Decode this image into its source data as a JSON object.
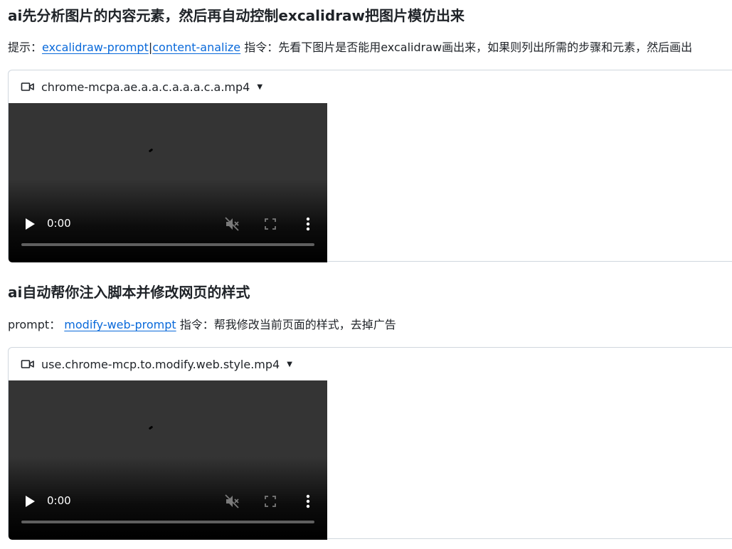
{
  "sections": [
    {
      "heading": "ai先分析图片的内容元素，然后再自动控制excalidraw把图片模仿出来",
      "prompt_label": "提示：",
      "links": [
        "excalidraw-prompt",
        "content-analize"
      ],
      "link_separator": "|",
      "instruction": " 指令：先看下图片是否能用excalidraw画出来，如果则列出所需的步骤和元素，然后画出",
      "video": {
        "file_name": "chrome-mcpa.ae.a.a.c.a.a.a.c.a.mp4",
        "time": "0:00",
        "progress": 0
      }
    },
    {
      "heading": "ai自动帮你注入脚本并修改网页的样式",
      "prompt_label": "prompt：",
      "links": [
        "modify-web-prompt"
      ],
      "instruction": " 指令：帮我修改当前页面的样式，去掉广告",
      "video": {
        "file_name": "use.chrome-mcp.to.modify.web.style.mp4",
        "time": "0:00",
        "progress": 0
      }
    }
  ],
  "icons": {
    "file_icon": "video-camera-icon",
    "file_menu": "caret-down-icon",
    "play": "play-icon",
    "mute": "muted-speaker-icon",
    "fullscreen": "fullscreen-icon",
    "more": "more-vertical-icon"
  },
  "colors": {
    "link": "#0969da",
    "text": "#1f2328",
    "border": "#d0d7de"
  }
}
